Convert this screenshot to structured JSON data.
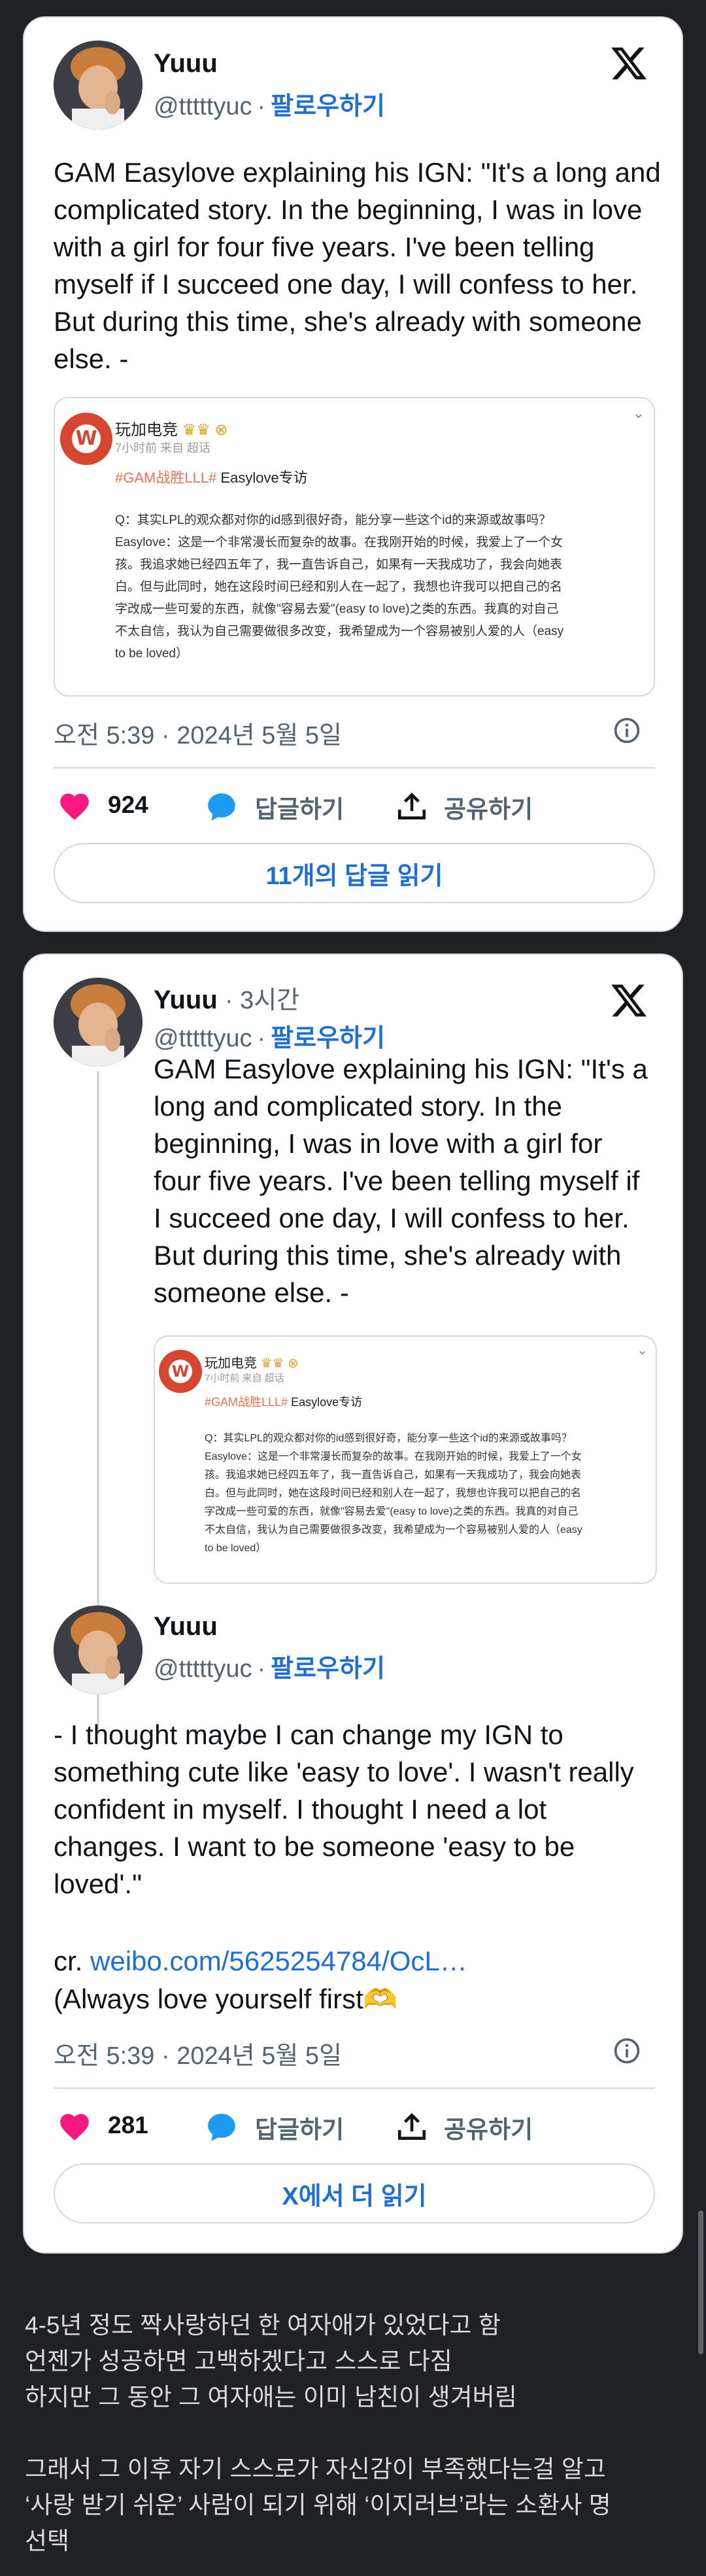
{
  "tweet1": {
    "author_name": "Yuuu",
    "handle": "@tttttyuc",
    "separator": "·",
    "follow_label": "팔로우하기",
    "text": "GAM Easylove explaining his IGN: \"It's a long and\ncomplicated story. In the beginning, I was in love\nwith a girl for four five years. I've been telling\nmyself if I succeed one day, I will confess to her.\nBut during this time, she's already with someone\nelse. -",
    "embed": {
      "source_name": "玩加电竞",
      "badges": "♛♛ ⊗",
      "meta": "7小时前 来自 超话",
      "hashtag": "#GAM战胜LLL#",
      "hashtag_suffix": " Easylove专访",
      "body": "Q：其实LPL的观众都对你的id感到很好奇，能分享一些这个id的来源或故事吗？\nEasylove：这是一个非常漫长而复杂的故事。在我刚开始的时候，我爱上了一个女\n孩。我追求她已经四五年了，我一直告诉自己，如果有一天我成功了，我会向她表\n白。但与此同时，她在这段时间已经和别人在一起了，我想也许我可以把自己的名\n字改成一些可爱的东西，就像\"容易去爱\"(easy to love)之类的东西。我真的对自己\n不太自信，我认为自己需要做很多改变，我希望成为一个容易被别人爱的人（easy\nto be loved）"
    },
    "datetime": "오전 5:39 · 2024년 5월 5일",
    "likes_count": "924",
    "reply_label": "답글하기",
    "share_label": "공유하기",
    "read_replies_label": "11개의 답글 읽기"
  },
  "tweet2": {
    "author_name": "Yuuu",
    "relative_time": "· 3시간",
    "handle": "@tttttyuc",
    "separator": "·",
    "follow_label": "팔로우하기",
    "text": "GAM Easylove explaining his IGN: \"It's a\nlong and complicated story. In the\nbeginning, I was in love with a girl for\nfour five years. I've been telling myself if\nI succeed one day, I will confess to her.\nBut during this time, she's already with\nsomeone else. -",
    "embed": {
      "source_name": "玩加电竞",
      "badges": "♛♛ ⊗",
      "meta": "7小时前 来自 超话",
      "hashtag": "#GAM战胜LLL#",
      "hashtag_suffix": " Easylove专访",
      "body": "Q：其实LPL的观众都对你的id感到很好奇，能分享一些这个id的来源或故事吗？\nEasylove：这是一个非常漫长而复杂的故事。在我刚开始的时候，我爱上了一个女\n孩。我追求她已经四五年了，我一直告诉自己，如果有一天我成功了，我会向她表\n白。但与此同时，她在这段时间已经和别人在一起了，我想也许我可以把自己的名\n字改成一些可爱的东西，就像\"容易去爱\"(easy to love)之类的东西。我真的对自己\n不太自信，我认为自己需要做很多改变，我希望成为一个容易被别人爱的人（easy\nto be loved）"
    }
  },
  "tweet3": {
    "author_name": "Yuuu",
    "handle": "@tttttyuc",
    "separator": "·",
    "follow_label": "팔로우하기",
    "text": "- I thought maybe I can change my IGN to\nsomething cute like 'easy to love'. I wasn't really\nconfident in myself. I thought I need a lot\nchanges. I want to be someone 'easy to be\nloved'.\"",
    "cr_prefix": "cr. ",
    "link_text": "weibo.com/5625254784/OcL…",
    "closing_text": "(Always love yourself first🫶",
    "datetime": "오전 5:39 · 2024년 5월 5일",
    "likes_count": "281",
    "reply_label": "답글하기",
    "share_label": "공유하기",
    "read_more_label": "X에서 더 읽기"
  },
  "caption": {
    "paragraph1": "4-5년 정도 짝사랑하던 한 여자애가 있었다고 함\n언젠가 성공하면 고백하겠다고 스스로 다짐\n하지만 그 동안 그 여자애는 이미 남친이 생겨버림",
    "paragraph2": "그래서 그 이후 자기 스스로가 자신감이 부족했다는걸 알고\n‘사랑 받기 쉬운’ 사람이 되기 위해 ‘이지러브’라는 소환사 명\n선택"
  },
  "icons": {
    "like": "heart-icon",
    "reply": "speech-bubble-icon",
    "share": "share-upload-icon",
    "info": "info-icon",
    "platform": "x-logo-icon"
  },
  "colors": {
    "like": "#f91880",
    "reply": "#1d9bf0",
    "link": "#1d6fd6",
    "page_background": "#202124"
  }
}
